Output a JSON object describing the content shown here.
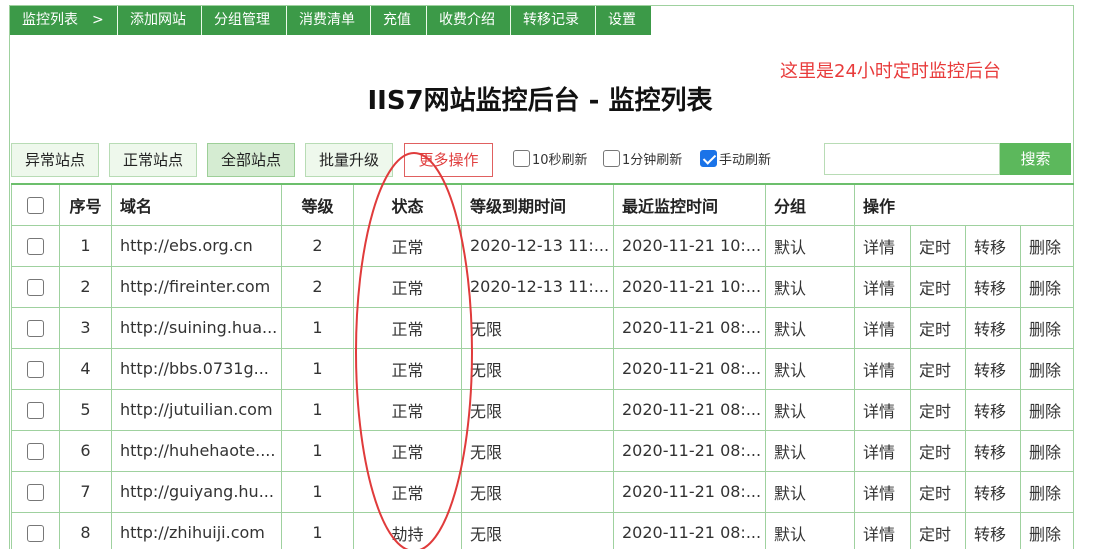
{
  "nav": {
    "items": [
      {
        "label": "监控列表　>"
      },
      {
        "label": "添加网站"
      },
      {
        "label": "分组管理"
      },
      {
        "label": "消费清单"
      },
      {
        "label": "充值"
      },
      {
        "label": "收费介绍"
      },
      {
        "label": "转移记录"
      },
      {
        "label": "设置"
      }
    ]
  },
  "annotation": "这里是24小时定时监控后台",
  "page_title": "IIS7网站监控后台 - 监控列表",
  "toolbar": {
    "abnormal_label": "异常站点",
    "normal_label": "正常站点",
    "all_label": "全部站点",
    "batch_upgrade_label": "批量升级",
    "more_ops_label": "更多操作",
    "refresh_10s_label": "10秒刷新",
    "refresh_1m_label": "1分钟刷新",
    "manual_refresh_label": "手动刷新",
    "search_value": "",
    "search_label": "搜索"
  },
  "table": {
    "headers": {
      "seq": "序号",
      "domain": "域名",
      "level": "等级",
      "status": "状态",
      "expire": "等级到期时间",
      "last_check": "最近监控时间",
      "group": "分组",
      "actions": "操作"
    },
    "action_labels": {
      "detail": "详情",
      "schedule": "定时",
      "transfer": "转移",
      "delete": "删除"
    },
    "rows": [
      {
        "seq": "1",
        "domain": "http://ebs.org.cn",
        "level": "2",
        "status": "正常",
        "expire": "2020-12-13 11:...",
        "last_check": "2020-11-21 10:...",
        "group": "默认"
      },
      {
        "seq": "2",
        "domain": "http://fireinter.com",
        "level": "2",
        "status": "正常",
        "expire": "2020-12-13 11:...",
        "last_check": "2020-11-21 10:...",
        "group": "默认"
      },
      {
        "seq": "3",
        "domain": "http://suining.hua...",
        "level": "1",
        "status": "正常",
        "expire": "无限",
        "last_check": "2020-11-21 08:...",
        "group": "默认"
      },
      {
        "seq": "4",
        "domain": "http://bbs.0731g...",
        "level": "1",
        "status": "正常",
        "expire": "无限",
        "last_check": "2020-11-21 08:...",
        "group": "默认"
      },
      {
        "seq": "5",
        "domain": "http://jutuilian.com",
        "level": "1",
        "status": "正常",
        "expire": "无限",
        "last_check": "2020-11-21 08:...",
        "group": "默认"
      },
      {
        "seq": "6",
        "domain": "http://huhehaote....",
        "level": "1",
        "status": "正常",
        "expire": "无限",
        "last_check": "2020-11-21 08:...",
        "group": "默认"
      },
      {
        "seq": "7",
        "domain": "http://guiyang.hu...",
        "level": "1",
        "status": "正常",
        "expire": "无限",
        "last_check": "2020-11-21 08:...",
        "group": "默认"
      },
      {
        "seq": "8",
        "domain": "http://zhihuiji.com",
        "level": "1",
        "status": "劫持",
        "expire": "无限",
        "last_check": "2020-11-21 08:...",
        "group": "默认"
      }
    ]
  },
  "colors": {
    "nav_bg": "#3c9a48",
    "accent_red": "#e03b3b",
    "border_green": "#9fd19f",
    "search_btn": "#5cb85c",
    "checkbox_checked": "#1a73e8"
  }
}
